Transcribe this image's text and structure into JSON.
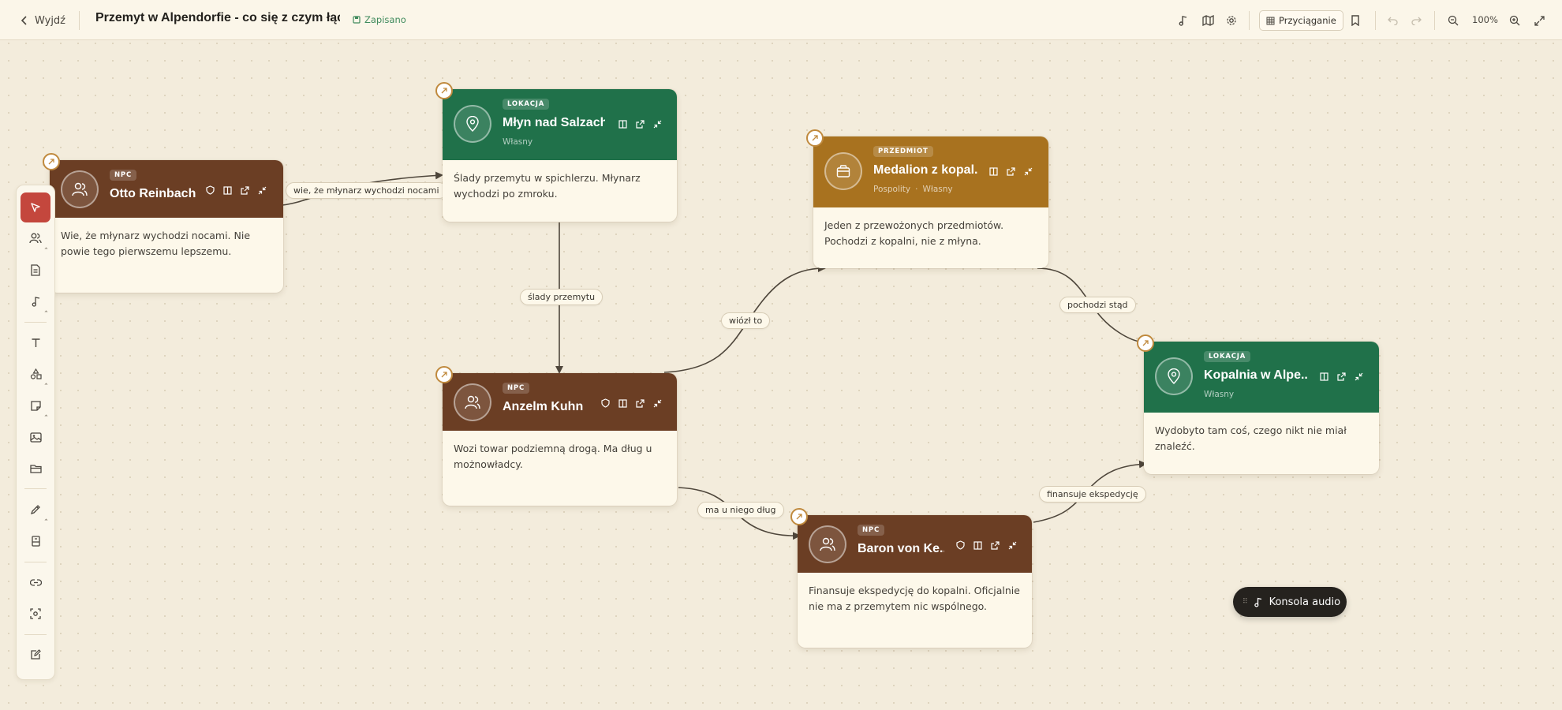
{
  "topbar": {
    "back_label": "Wyjdź",
    "doc_title": "Przemyt w Alpendorfie - co się z czym łączy",
    "saved_label": "Zapisano",
    "snap_label": "Przyciąganie",
    "zoom_level": "100%"
  },
  "cards": {
    "otto": {
      "badge": "NPC",
      "title": "Otto Reinbach",
      "body": "Wie, że młynarz wychodzi nocami. Nie powie tego pierwszemu lepszemu."
    },
    "mlyn": {
      "badge": "LOKACJA",
      "title": "Młyn nad Salzach",
      "subtitle": "Własny",
      "body": "Ślady przemytu w spichlerzu. Młynarz wychodzi po zmroku."
    },
    "medalion": {
      "badge": "PRZEDMIOT",
      "title": "Medalion z kopal...",
      "subtitle_a": "Pospolity",
      "subtitle_b": "Własny",
      "body": "Jeden z przewożonych przedmiotów. Pochodzi z kopalni, nie z młyna."
    },
    "anzelm": {
      "badge": "NPC",
      "title": "Anzelm Kuhn",
      "body": "Wozi towar podziemną drogą. Ma dług u możnowładcy."
    },
    "kopalnia": {
      "badge": "LOKACJA",
      "title": "Kopalnia w Alpe...",
      "subtitle": "Własny",
      "body": "Wydobyto tam coś, czego nikt nie miał znaleźć."
    },
    "baron": {
      "badge": "NPC",
      "title": "Baron von Ke...",
      "body": "Finansuje ekspedycję do kopalni. Oficjalnie nie ma z przemytem nic wspólnego."
    }
  },
  "edges": {
    "otto_mlyn": "wie, że młynarz wychodzi nocami",
    "mlyn_anzelm": "ślady przemytu",
    "anzelm_medalion": "wiózł to",
    "medalion_kopalnia": "pochodzi stąd",
    "anzelm_baron": "ma u niego dług",
    "baron_kopalnia": "finansuje ekspedycję"
  },
  "audio_console_label": "Konsola audio",
  "colors": {
    "npc": "#6b3e24",
    "location": "#20714a",
    "item": "#a8721f",
    "accent": "#c4473d"
  }
}
